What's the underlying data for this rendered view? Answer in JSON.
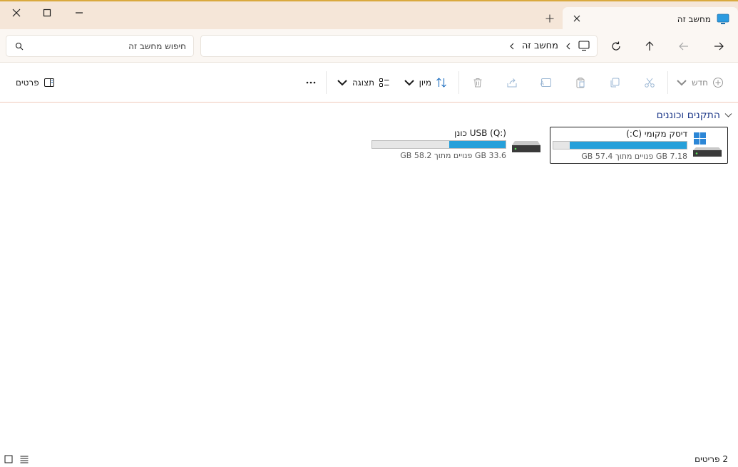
{
  "window": {
    "title": "מחשב זה"
  },
  "tab": {
    "title": "מחשב זה"
  },
  "address": {
    "location": "מחשב זה"
  },
  "search": {
    "placeholder": "חיפוש מחשב זה"
  },
  "toolbar": {
    "new_label": "חדש",
    "sort_label": "מיון",
    "view_label": "תצוגה",
    "details_label": "פרטים"
  },
  "section": {
    "title": "התקנים וכוננים"
  },
  "drives": [
    {
      "name": "דיסק מקומי (C:)",
      "space": "7.18 GB פנויים מתוך 57.4 GB",
      "used_fraction": 0.875,
      "selected": true,
      "icon": "windows-drive-icon"
    },
    {
      "name": "USB (Q:) כונן",
      "space": "33.6 GB פנויים מתוך 58.2 GB",
      "used_fraction": 0.42,
      "selected": false,
      "icon": "usb-drive-icon"
    }
  ],
  "status": {
    "count": "2 פריטים"
  },
  "colors": {
    "accent": "#26a0da",
    "section_title": "#1f3a8a",
    "titlebar": "#f5e6d8",
    "navbar": "#fbf7f3"
  }
}
